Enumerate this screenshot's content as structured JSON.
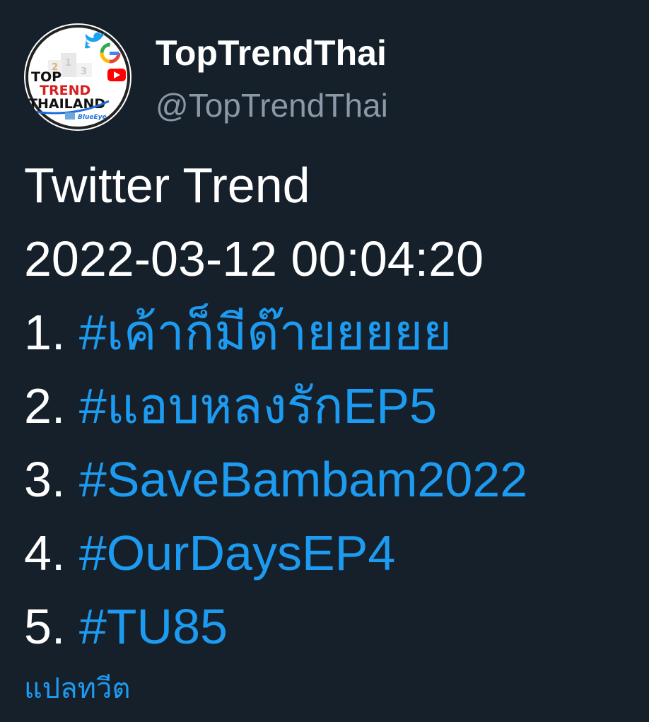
{
  "profile": {
    "display_name": "TopTrendThai",
    "handle": "@TopTrendThai",
    "avatar": {
      "logo_text_top": "TOP",
      "logo_text_mid": "TREND",
      "logo_text_bottom": "THAILAND",
      "logo_tagline": "BlueEye",
      "icons": [
        "twitter-bird-icon",
        "google-g-icon",
        "youtube-icon"
      ]
    }
  },
  "tweet": {
    "heading": "Twitter Trend",
    "timestamp": "2022-03-12 00:04:20",
    "trends": [
      {
        "rank": "1.",
        "hashtag": "#เค้าก็มีด๊ายยยยย"
      },
      {
        "rank": "2.",
        "hashtag": "#แอบหลงรักEP5"
      },
      {
        "rank": "3.",
        "hashtag": "#SaveBambam2022"
      },
      {
        "rank": "4.",
        "hashtag": "#OurDaysEP4"
      },
      {
        "rank": "5.",
        "hashtag": "#TU85"
      }
    ],
    "translate_label": "แปลทวีต"
  },
  "colors": {
    "background": "#15202b",
    "text": "#ffffff",
    "secondary_text": "#8b98a5",
    "link": "#1d9bf0"
  }
}
